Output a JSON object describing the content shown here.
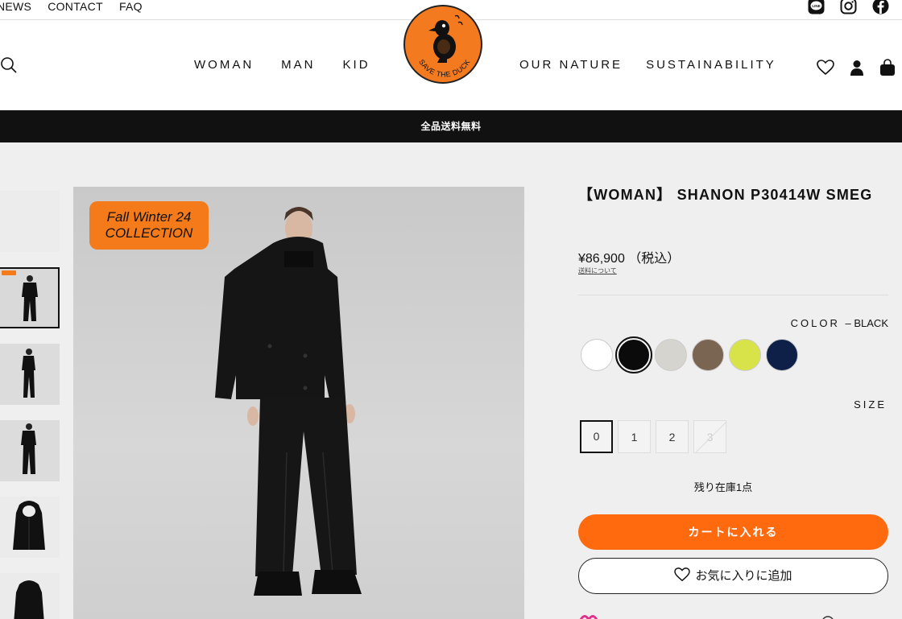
{
  "util_nav": [
    "NEWS",
    "CONTACT",
    "FAQ"
  ],
  "social_icons": [
    "line-icon",
    "instagram-icon",
    "facebook-icon"
  ],
  "main_nav": {
    "left": [
      "WOMAN",
      "MAN",
      "KID"
    ],
    "right": [
      "OUR NATURE",
      "SUSTAINABILITY"
    ]
  },
  "logo_text": "SAVE THE DUCK",
  "header_icons": [
    "heart-icon",
    "account-icon",
    "bag-icon"
  ],
  "banner": "全品送料無料",
  "gallery": {
    "badge_line1": "Fall Winter 24",
    "badge_line2": "COLLECTION"
  },
  "product": {
    "title": "【WOMAN】 SHANON P30414W SMEG",
    "price": "¥86,900 （税込）",
    "shipping_link": "送料について",
    "color_label": "COLOR",
    "color_value": "– BLACK",
    "colors": [
      "#ffffff",
      "#0b0b0b",
      "#d6d4ce",
      "#7a6452",
      "#d8e34a",
      "#0e1f48"
    ],
    "selected_color_index": 1,
    "size_label": "SIZE",
    "sizes": [
      "0",
      "1",
      "2",
      "3"
    ],
    "stock_text": "残り在庫1点",
    "add_to_cart": "カートに入れる",
    "add_favorite": "お気に入りに追加"
  },
  "colors": {
    "accent": "#ff6a0f",
    "banner_bg": "#111111",
    "badge": "#f47a1a"
  }
}
